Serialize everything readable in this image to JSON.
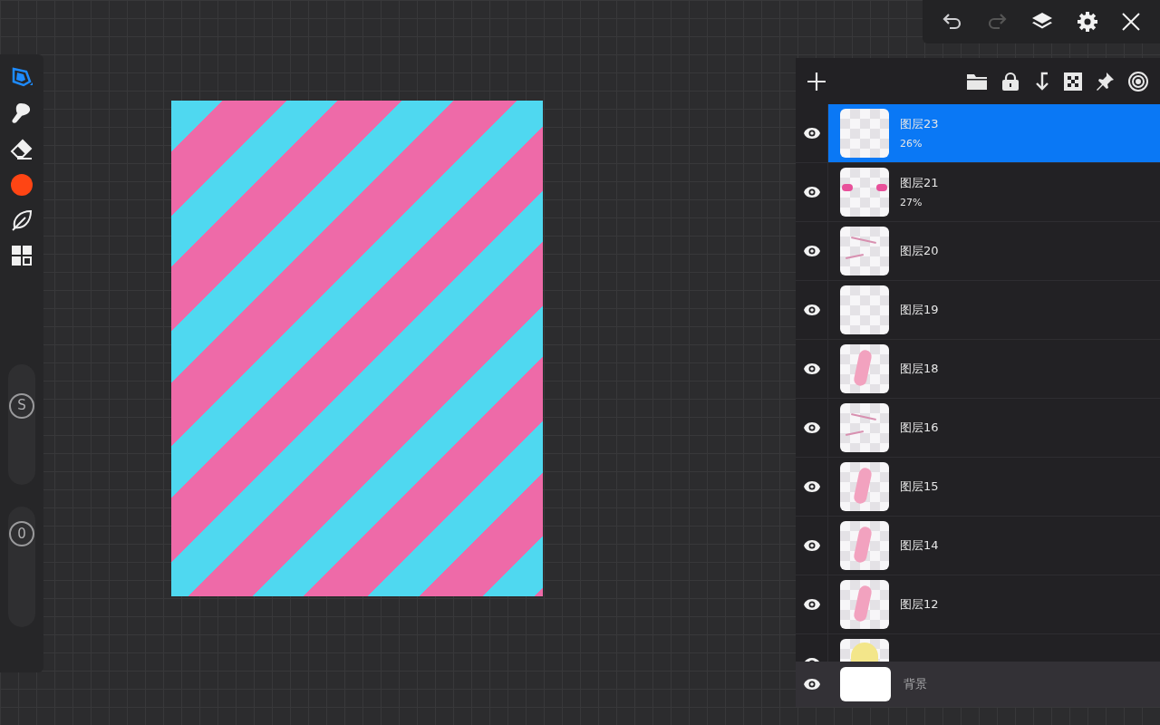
{
  "top_bar": {
    "undo_enabled": true,
    "redo_enabled": false
  },
  "tools": [
    {
      "kind": "pen",
      "selected": true
    },
    {
      "kind": "smudge",
      "selected": false
    },
    {
      "kind": "eraser",
      "selected": false
    },
    {
      "kind": "color",
      "selected": false,
      "color": "#ff4514"
    },
    {
      "kind": "leaf",
      "selected": false
    },
    {
      "kind": "grid",
      "selected": false
    }
  ],
  "sliders": [
    {
      "label": "S",
      "level": 0.7
    },
    {
      "label": "0",
      "level": 0.85
    }
  ],
  "layers": [
    {
      "name": "图层23",
      "opacity": "26%",
      "selected": true,
      "visible": true,
      "kind": "text"
    },
    {
      "name": "图层21",
      "opacity": "27%",
      "selected": false,
      "visible": true,
      "kind": "blush"
    },
    {
      "name": "图层20",
      "selected": false,
      "visible": true,
      "kind": "lines"
    },
    {
      "name": "图层19",
      "selected": false,
      "visible": true,
      "kind": "empty"
    },
    {
      "name": "图层18",
      "selected": false,
      "visible": true,
      "kind": "pink"
    },
    {
      "name": "图层16",
      "selected": false,
      "visible": true,
      "kind": "lines"
    },
    {
      "name": "图层15",
      "selected": false,
      "visible": true,
      "kind": "pink"
    },
    {
      "name": "图层14",
      "selected": false,
      "visible": true,
      "kind": "pink"
    },
    {
      "name": "图层12",
      "selected": false,
      "visible": true,
      "kind": "pink"
    },
    {
      "selected": false,
      "visible": true,
      "kind": "yellow"
    }
  ],
  "background_layer": {
    "name": "背景",
    "visible": true
  }
}
